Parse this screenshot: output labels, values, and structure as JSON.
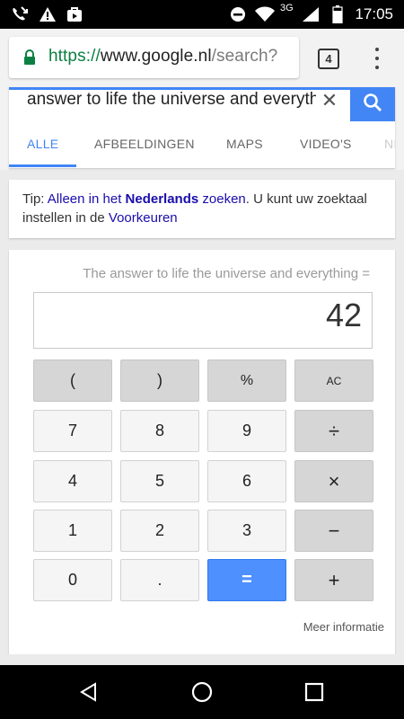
{
  "status_bar": {
    "time": "17:05",
    "network": "3G",
    "icons": [
      "missed-call-icon",
      "warning-icon",
      "bag-icon",
      "dnd-icon",
      "wifi-icon",
      "cell-signal-icon",
      "battery-icon"
    ]
  },
  "browser": {
    "url_scheme": "https://",
    "url_host": "www.google.nl",
    "url_path": "/search?",
    "tab_count": "4"
  },
  "search": {
    "query": "answer to life the universe and everything",
    "tabs": [
      {
        "label": "ALLE",
        "active": true
      },
      {
        "label": "AFBEELDINGEN",
        "active": false
      },
      {
        "label": "MAPS",
        "active": false
      },
      {
        "label": "VIDEO'S",
        "active": false
      },
      {
        "label": "NIEUWS",
        "active": false
      }
    ]
  },
  "tip": {
    "prefix": "Tip: ",
    "link_part1": "Alleen in het ",
    "link_bold": "Nederlands",
    "link_part2": " zoeken",
    "middle": ". U kunt uw zoektaal instellen in de ",
    "link_settings": "Voorkeuren"
  },
  "calculator": {
    "expression": "The answer to life the universe and everything =",
    "result": "42",
    "keys": {
      "open_paren": "(",
      "close_paren": ")",
      "percent": "%",
      "clear": "AC",
      "seven": "7",
      "eight": "8",
      "nine": "9",
      "divide": "÷",
      "four": "4",
      "five": "5",
      "six": "6",
      "multiply": "×",
      "one": "1",
      "two": "2",
      "three": "3",
      "minus": "−",
      "zero": "0",
      "dot": ".",
      "equals": "=",
      "plus": "+"
    },
    "more_info": "Meer informatie"
  },
  "colors": {
    "accent_blue": "#4285f4",
    "secure_green": "#0b8043",
    "link": "#1a0dab"
  }
}
